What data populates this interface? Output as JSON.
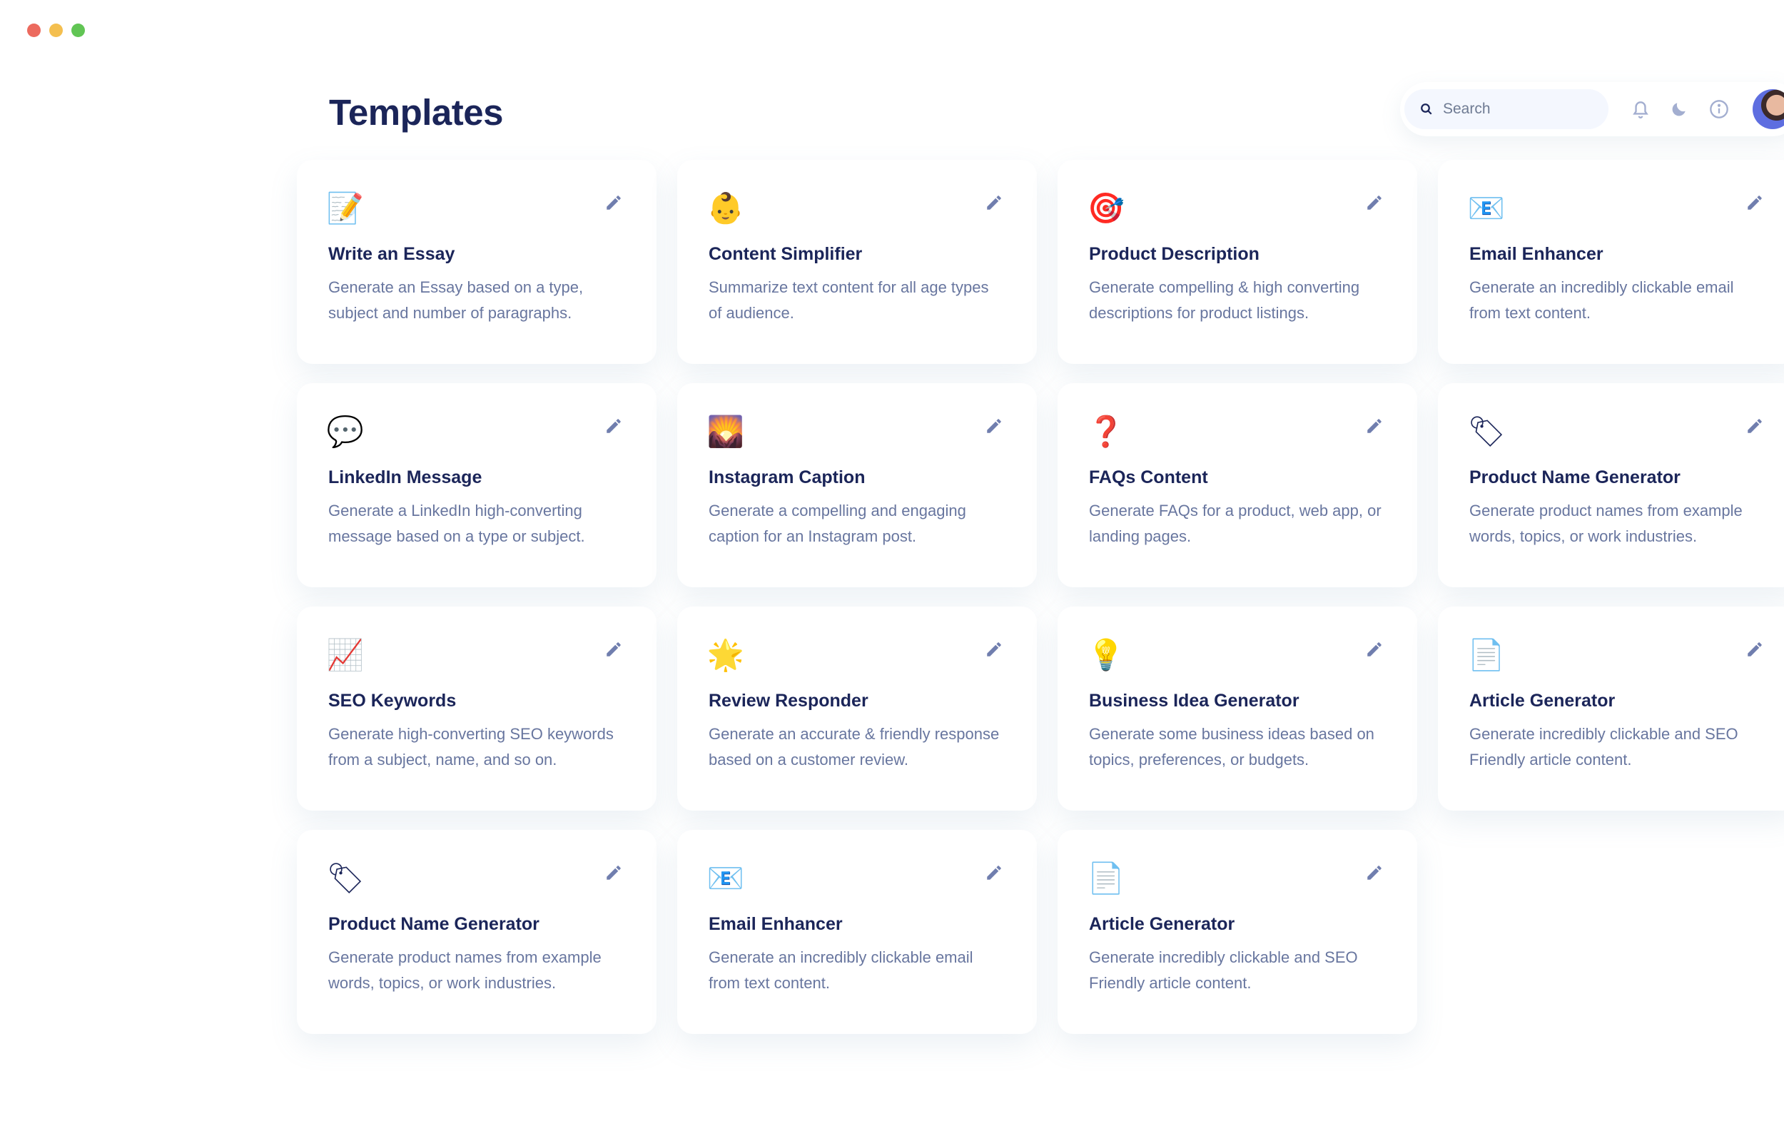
{
  "window": {
    "controls": [
      "close",
      "minimize",
      "maximize"
    ]
  },
  "page": {
    "title": "Templates"
  },
  "header": {
    "search_placeholder": "Search",
    "icons": [
      "bell-icon",
      "moon-icon",
      "info-icon"
    ]
  },
  "cards": [
    {
      "icon": "memo",
      "emoji": "📝",
      "title": "Write an Essay",
      "desc": "Generate an Essay based on a type, subject and number of paragraphs."
    },
    {
      "icon": "baby",
      "emoji": "👶",
      "title": "Content Simplifier",
      "desc": "Summarize text content for all age types of audience."
    },
    {
      "icon": "target",
      "emoji": "🎯",
      "title": "Product Description",
      "desc": "Generate compelling & high converting descriptions for product listings."
    },
    {
      "icon": "envelope",
      "emoji": "📧",
      "title": "Email Enhancer",
      "desc": "Generate an incredibly clickable email from text content."
    },
    {
      "icon": "speech-bubble",
      "emoji": "💬",
      "title": "LinkedIn Message",
      "desc": "Generate a LinkedIn high-converting message based on a type or subject."
    },
    {
      "icon": "sunrise",
      "emoji": "🌄",
      "title": "Instagram Caption",
      "desc": "Generate a compelling and engaging caption for an Instagram post."
    },
    {
      "icon": "question-mark",
      "emoji": "❓",
      "title": "FAQs Content",
      "desc": "Generate FAQs for a product, web app, or landing pages."
    },
    {
      "icon": "tag",
      "emoji": "🏷",
      "title": "Product Name Generator",
      "desc": "Generate product names from example words, topics, or work industries."
    },
    {
      "icon": "chart-up",
      "emoji": "📈",
      "title": "SEO Keywords",
      "desc": "Generate high-converting SEO keywords from a subject, name, and so on."
    },
    {
      "icon": "star",
      "emoji": "🌟",
      "title": "Review Responder",
      "desc": "Generate an accurate & friendly response based on a customer review."
    },
    {
      "icon": "lightbulb",
      "emoji": "💡",
      "title": "Business Idea Generator",
      "desc": "Generate some business ideas based on topics, preferences, or budgets."
    },
    {
      "icon": "document",
      "emoji": "📄",
      "title": "Article Generator",
      "desc": "Generate incredibly clickable and SEO Friendly article content."
    },
    {
      "icon": "tag",
      "emoji": "🏷",
      "title": "Product Name Generator",
      "desc": "Generate product names from example words, topics, or work industries."
    },
    {
      "icon": "envelope",
      "emoji": "📧",
      "title": "Email Enhancer",
      "desc": "Generate an incredibly clickable email from text content."
    },
    {
      "icon": "document",
      "emoji": "📄",
      "title": "Article Generator",
      "desc": "Generate incredibly clickable and SEO Friendly article content."
    }
  ],
  "colors": {
    "heading": "#1b2559",
    "body_text": "#68769f",
    "icon_gray": "#707eae",
    "search_bg": "#f4f7fe"
  }
}
